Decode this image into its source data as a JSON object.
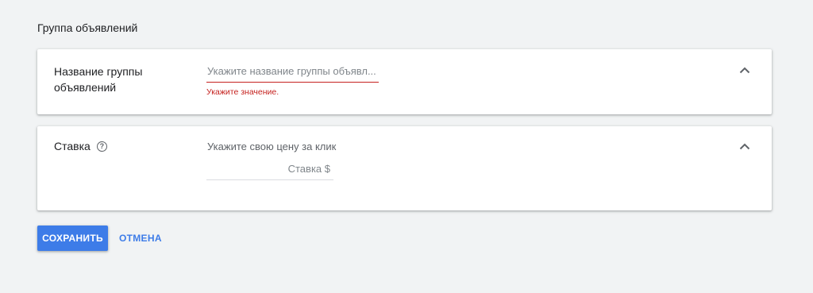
{
  "section_title": "Группа объявлений",
  "name_card": {
    "label": "Название группы объявлений",
    "input_placeholder": "Укажите название группы объявл...",
    "input_value": "",
    "error": "Укажите значение.",
    "chevron_icon": "chevron-up-icon"
  },
  "bid_card": {
    "label": "Ставка",
    "help_icon": "help-circle-icon",
    "help_glyph": "?",
    "hint": "Укажите свою цену за клик",
    "input_placeholder": "Ставка $",
    "input_value": "",
    "chevron_icon": "chevron-up-icon"
  },
  "actions": {
    "save_label": "СОХРАНИТЬ",
    "cancel_label": "ОТМЕНА"
  },
  "colors": {
    "background": "#f1f3f4",
    "accent": "#3d7ce8",
    "error": "#c5221f"
  }
}
